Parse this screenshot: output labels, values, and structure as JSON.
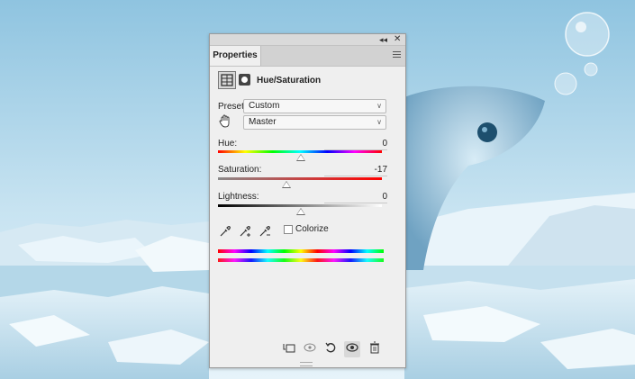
{
  "window": {
    "tab": "Properties",
    "collapse_glyph": "◂◂",
    "close_glyph": "✕"
  },
  "panel": {
    "title": "Hue/Saturation",
    "preset_label": "Preset:",
    "preset_value": "Custom",
    "channel_value": "Master",
    "hue_label": "Hue:",
    "hue_value": "0",
    "saturation_label": "Saturation:",
    "saturation_value": "-17",
    "lightness_label": "Lightness:",
    "lightness_value": "0",
    "colorize_label": "Colorize",
    "colorize_checked": false
  },
  "icons": {
    "adjustment": "hue-saturation-adjustment-icon",
    "mask": "layer-mask-icon",
    "hand": "targeted-adjustment-hand-icon",
    "eyedroppers": [
      "eyedropper-icon",
      "eyedropper-add-icon",
      "eyedropper-subtract-icon"
    ],
    "bottom": [
      "clip-to-layer-icon",
      "view-previous-state-icon",
      "reset-icon",
      "visibility-icon",
      "delete-icon"
    ]
  },
  "colors": {
    "panel_bg": "#efefef",
    "tab_bar": "#d2d2d2"
  }
}
